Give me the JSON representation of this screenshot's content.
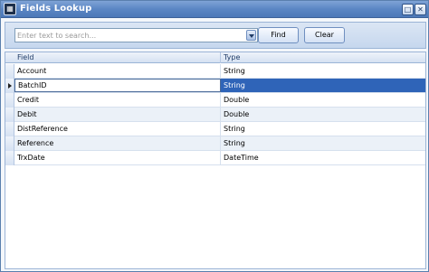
{
  "window": {
    "title": "Fields Lookup",
    "app_icon": "app-logo-icon",
    "buttons": {
      "maximize": "□",
      "close": "✕"
    }
  },
  "search": {
    "placeholder": "Enter text to search...",
    "value": "",
    "find_label": "Find",
    "clear_label": "Clear"
  },
  "grid": {
    "columns": [
      "Field",
      "Type"
    ],
    "rows": [
      {
        "field": "Account",
        "type": "String"
      },
      {
        "field": "BatchID",
        "type": "String"
      },
      {
        "field": "Credit",
        "type": "Double"
      },
      {
        "field": "Debit",
        "type": "Double"
      },
      {
        "field": "DistReference",
        "type": "String"
      },
      {
        "field": "Reference",
        "type": "String"
      },
      {
        "field": "TrxDate",
        "type": "DateTime"
      }
    ],
    "focused_row": 1
  },
  "colors": {
    "title_bar": "#5b86c4",
    "selection": "#2f64b8",
    "alt_row": "#ebf1f8"
  }
}
